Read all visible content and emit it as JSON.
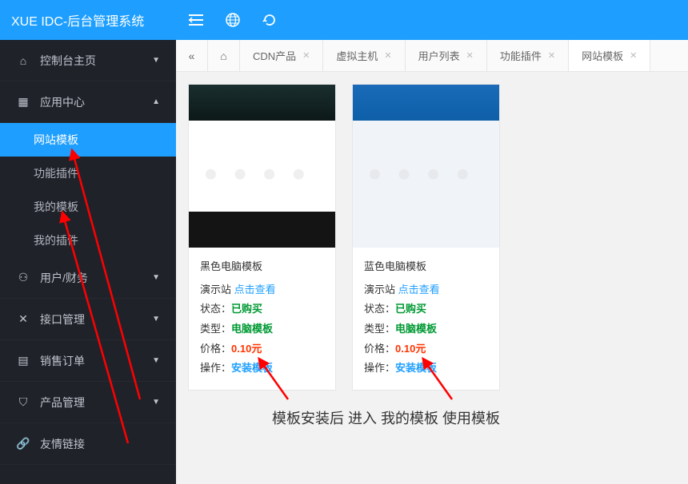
{
  "app_title": "XUE IDC-后台管理系统",
  "nav": {
    "console": "控制台主页",
    "appcenter": "应用中心",
    "sub_templates": "网站模板",
    "sub_plugins": "功能插件",
    "sub_my_templates": "我的模板",
    "sub_my_plugins": "我的插件",
    "user_finance": "用户/财务",
    "api_manage": "接口管理",
    "sales_order": "销售订单",
    "product_manage": "产品管理",
    "friend_links": "友情链接"
  },
  "tabs": {
    "cdn": "CDN产品",
    "vhost": "虚拟主机",
    "userlist": "用户列表",
    "plugin": "功能插件",
    "template": "网站模板"
  },
  "cards": [
    {
      "title": "黑色电脑模板",
      "demo_label": "演示站",
      "demo_link": "点击查看",
      "status_label": "状态：",
      "status_value": "已购买",
      "type_label": "类型：",
      "type_value": "电脑模板",
      "price_label": "价格：",
      "price_value": "0.10元",
      "action_label": "操作：",
      "action_value": "安装模板"
    },
    {
      "title": "蓝色电脑模板",
      "demo_label": "演示站",
      "demo_link": "点击查看",
      "status_label": "状态：",
      "status_value": "已购买",
      "type_label": "类型：",
      "type_value": "电脑模板",
      "price_label": "价格：",
      "price_value": "0.10元",
      "action_label": "操作：",
      "action_value": "安装模板"
    }
  ],
  "annotation_text": "模板安装后 进入 我的模板 使用模板"
}
